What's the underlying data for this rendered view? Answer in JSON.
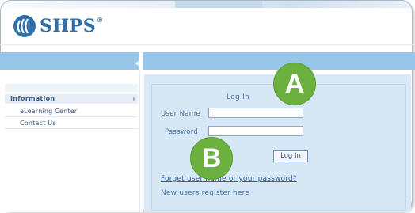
{
  "brand": {
    "name": "SHPS",
    "reg": "®"
  },
  "sidebar": {
    "section_title": "Information",
    "items": [
      {
        "label": "eLearning Center"
      },
      {
        "label": "Contact Us"
      }
    ]
  },
  "login": {
    "title": "Log In",
    "username_label": "User Name",
    "password_label": "Password",
    "username_value": "",
    "password_value": "",
    "button_label": "Log In",
    "forgot_link": "Forget user name or your password?",
    "register_link": "New users register here"
  },
  "annotations": {
    "a": "A",
    "b": "B"
  },
  "colors": {
    "nav_bar": "#96c7e9",
    "panel_bg": "#d6e8f6",
    "badge_green": "#6cb040",
    "brand_blue": "#2f6ea8"
  }
}
